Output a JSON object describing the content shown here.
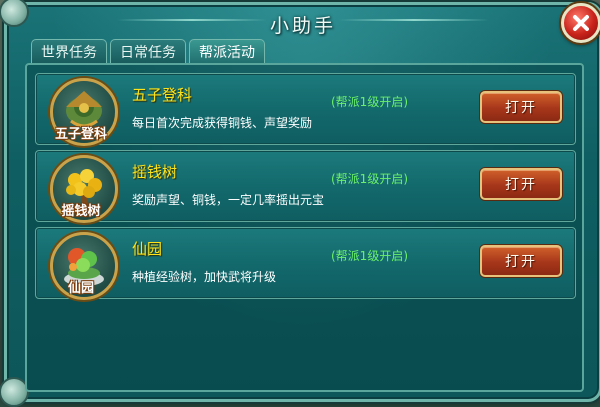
{
  "window": {
    "title": "小助手"
  },
  "tabs": [
    {
      "label": "世界任务",
      "active": false
    },
    {
      "label": "日常任务",
      "active": false
    },
    {
      "label": "帮派活动",
      "active": true
    }
  ],
  "activities": [
    {
      "icon_name": "imperial-exam-icon",
      "icon_label": "五子登科",
      "title": "五子登科",
      "description": "每日首次完成获得铜钱、声望奖励",
      "unlock_note": "(帮派1级开启)",
      "button_label": "打开"
    },
    {
      "icon_name": "money-tree-icon",
      "icon_label": "摇钱树",
      "title": "摇钱树",
      "description": "奖励声望、铜钱，一定几率摇出元宝",
      "unlock_note": "(帮派1级开启)",
      "button_label": "打开"
    },
    {
      "icon_name": "fairy-garden-icon",
      "icon_label": "仙园",
      "title": "仙园",
      "description": "种植经验树，加快武将升级",
      "unlock_note": "(帮派1级开启)",
      "button_label": "打开"
    }
  ],
  "colors": {
    "title_text": "#ffe31a",
    "unlock_text": "#6cf06a",
    "button_fill": "#a6361a"
  }
}
